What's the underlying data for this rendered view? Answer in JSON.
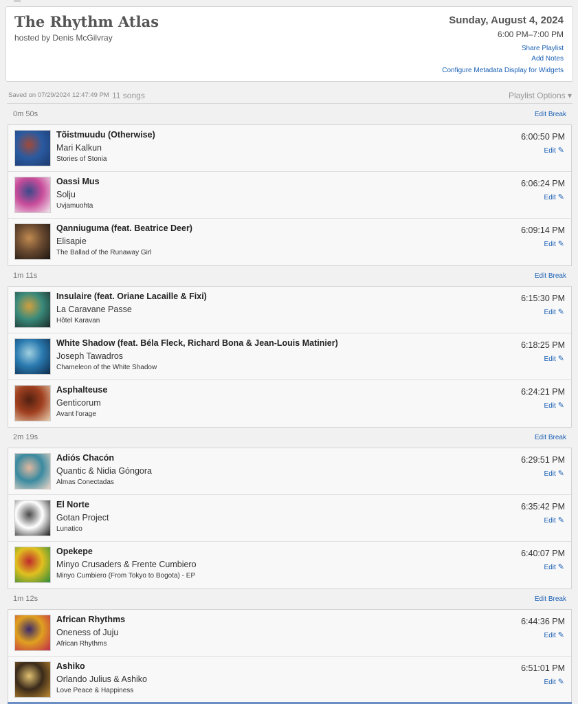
{
  "show": {
    "title": "The Rhythm Atlas",
    "host": "hosted by Denis McGilvray",
    "date": "Sunday, August 4, 2024",
    "time_range": "6:00 PM–7:00 PM",
    "links": {
      "share": "Share Playlist",
      "notes": "Add Notes",
      "configure": "Configure Metadata Display for Widgets"
    }
  },
  "meta": {
    "saved": "Saved on 07/29/2024 12:47:49 PM",
    "song_count": "11 songs",
    "options": "Playlist Options ▾"
  },
  "edit_break_label": "Edit Break",
  "edit_label": "Edit",
  "breaks": [
    "0m 50s",
    "1m 11s",
    "2m 19s",
    "1m 12s"
  ],
  "tracks": [
    {
      "title": "Tõistmuudu (Otherwise)",
      "artist": "Mari Kalkun",
      "album": "Stories of Stonia",
      "time": "6:00:50 PM",
      "art_colors": [
        "#1d3a6e",
        "#2a5aa0",
        "#a04a3a"
      ]
    },
    {
      "title": "Oassi Mus",
      "artist": "Solju",
      "album": "Uvjamuohta",
      "time": "6:06:24 PM",
      "art_colors": [
        "#f2e8ee",
        "#c84c9a",
        "#3a4a8a"
      ]
    },
    {
      "title": "Qanniuguma (feat. Beatrice Deer)",
      "artist": "Elisapie",
      "album": "The Ballad of the Runaway Girl",
      "time": "6:09:14 PM",
      "art_colors": [
        "#1a1410",
        "#6a4a30",
        "#c08a50"
      ]
    },
    {
      "title": "Insulaire (feat. Oriane Lacaille & Fixi)",
      "artist": "La Caravane Passe",
      "album": "Hôtel Karavan",
      "time": "6:15:30 PM",
      "art_colors": [
        "#1a2a28",
        "#3a8a7a",
        "#d0a040"
      ]
    },
    {
      "title": "White Shadow (feat. Béla Fleck, Richard Bona & Jean-Louis Matinier)",
      "artist": "Joseph Tawadros",
      "album": "Chameleon of the White Shadow",
      "time": "6:18:25 PM",
      "art_colors": [
        "#0e2a4a",
        "#2a7ab0",
        "#a0d0e0"
      ]
    },
    {
      "title": "Asphalteuse",
      "artist": "Genticorum",
      "album": "Avant l'orage",
      "time": "6:24:21 PM",
      "art_colors": [
        "#e8d0b0",
        "#a04020",
        "#502010"
      ]
    },
    {
      "title": "Adiós Chacón",
      "artist": "Quantic & Nidia Góngora",
      "album": "Almas Conectadas",
      "time": "6:29:51 PM",
      "art_colors": [
        "#f0d8c8",
        "#3a8aa0",
        "#e0b8a0"
      ]
    },
    {
      "title": "El Norte",
      "artist": "Gotan Project",
      "album": "Lunatico",
      "time": "6:35:42 PM",
      "art_colors": [
        "#1a1a1a",
        "#ffffff",
        "#4a4a4a"
      ]
    },
    {
      "title": "Opekepe",
      "artist": "Minyo Crusaders & Frente Cumbiero",
      "album": "Minyo Cumbiero (From Tokyo to Bogota) - EP",
      "time": "6:40:07 PM",
      "art_colors": [
        "#2a8a3a",
        "#e0c020",
        "#c02a2a"
      ]
    },
    {
      "title": "African Rhythms",
      "artist": "Oneness of Juju",
      "album": "African Rhythms",
      "time": "6:44:36 PM",
      "art_colors": [
        "#c02a4a",
        "#e0a020",
        "#3a2a6a"
      ]
    },
    {
      "title": "Ashiko",
      "artist": "Orlando Julius & Ashiko",
      "album": "Love Peace & Happiness",
      "time": "6:51:01 PM",
      "art_colors": [
        "#c08a30",
        "#3a2a1a",
        "#e0c070"
      ]
    }
  ]
}
